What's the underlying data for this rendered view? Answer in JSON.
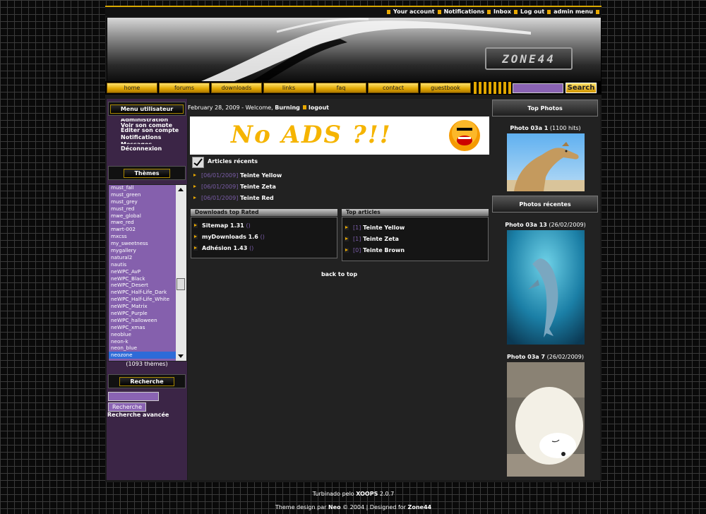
{
  "top_links": [
    "Your account",
    "Notifications",
    "Inbox",
    "Log out",
    "admin menu"
  ],
  "banner_logo": "ZONE44",
  "nav": [
    "home",
    "forums",
    "downloads",
    "links",
    "faq",
    "contact",
    "guestbook"
  ],
  "search_button": "Search",
  "left": {
    "user_menu_title": "Menu utilisateur",
    "user_menu_items": [
      "Administration",
      "Voir son compte",
      "Editer son compte",
      "Notifications",
      "Messages",
      "Déconnexion"
    ],
    "themes_title": "Thèmes",
    "themes": [
      "must_fall",
      "must_green",
      "must_grey",
      "must_red",
      "mwe_global",
      "mwe_red",
      "mwrt-002",
      "mxcss",
      "my_sweetness",
      "mygallery",
      "natural2",
      "nautis",
      "neWPC_AvP",
      "neWPC_Black",
      "neWPC_Desert",
      "neWPC_Half-Life_Dark",
      "neWPC_Half-Life_White",
      "neWPC_Matrix",
      "neWPC_Purple",
      "neWPC_halloween",
      "neWPC_xmas",
      "neoblue",
      "neon-k",
      "neon_blue",
      "neozone"
    ],
    "themes_selected": "neozone",
    "themes_count": "(1093 thèmes)",
    "search_title": "Recherche",
    "search_button": "Recherche",
    "advanced_search": "Recherche avancée"
  },
  "main": {
    "welcome_date": "February 28, 2009 - Welcome,",
    "welcome_user": "Burning",
    "logout": "logout",
    "ad_text": "No ADS ?!!",
    "recent_title": "Articles récents",
    "recent": [
      {
        "date": "[06/01/2009]",
        "title": "Teinte Yellow"
      },
      {
        "date": "[06/01/2009]",
        "title": "Teinte Zeta"
      },
      {
        "date": "[06/01/2009]",
        "title": "Teinte Red"
      }
    ],
    "downloads_title": "Downloads top Rated",
    "downloads": [
      {
        "name": "Sitemap 1.31",
        "suffix": "()"
      },
      {
        "name": "myDownloads 1.6",
        "suffix": "()"
      },
      {
        "name": "Adhésion 1.43",
        "suffix": "()"
      }
    ],
    "top_articles_title": "Top articles",
    "top_articles": [
      {
        "count": "[1]",
        "title": "Teinte Yellow"
      },
      {
        "count": "[1]",
        "title": "Teinte Zeta"
      },
      {
        "count": "[0]",
        "title": "Teinte Brown"
      }
    ],
    "back_to_top": "back to top"
  },
  "right": {
    "top_photos_title": "Top Photos",
    "top_photo": {
      "name": "Photo 03a 1",
      "meta": "(1100 hits)"
    },
    "recent_photos_title": "Photos récentes",
    "recent_photos": [
      {
        "name": "Photo 03a 13",
        "meta": "(26/02/2009)"
      },
      {
        "name": "Photo 03a 7",
        "meta": "(26/02/2009)"
      }
    ]
  },
  "footer": {
    "powered_prefix": "Turbinado pelo",
    "powered_name": "XOOPS",
    "powered_version": "2.0.7",
    "design_prefix": "Theme design  par",
    "design_author": "Neo",
    "design_rest": "© 2004 | Designed for",
    "design_site": "Zone44"
  }
}
